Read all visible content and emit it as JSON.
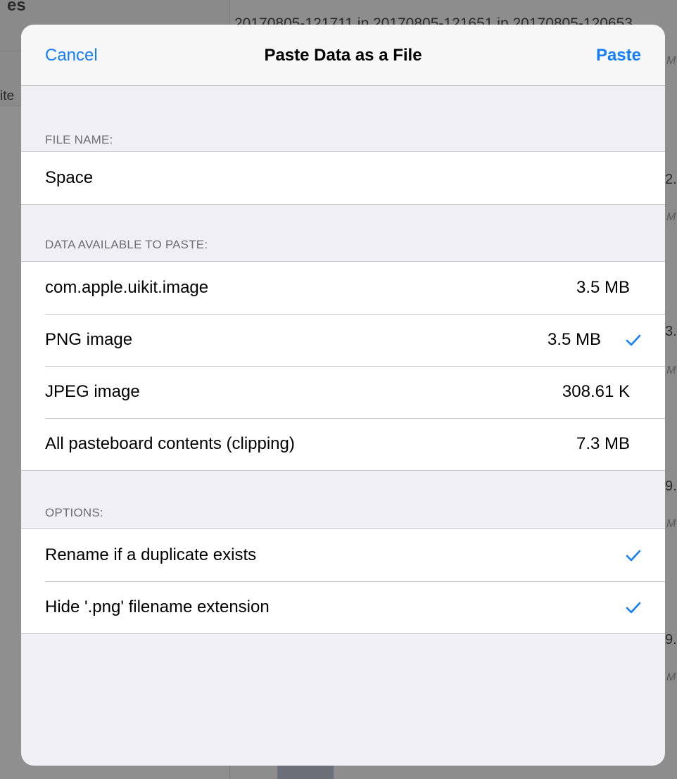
{
  "background": {
    "left_title_fragment": "es",
    "left_button_fragment": "ite",
    "filenames_row": "20170805-121711.jp  20170805-121651.jp  20170805-120653.",
    "right_edge_fragments": [
      "M",
      "2.",
      "M",
      "3.",
      "M",
      "9.",
      "M",
      "9.",
      "M"
    ]
  },
  "nav": {
    "cancel_label": "Cancel",
    "title": "Paste Data as a File",
    "paste_label": "Paste"
  },
  "file_name": {
    "header": "FILE NAME:",
    "value": "Space"
  },
  "data_available": {
    "header": "DATA AVAILABLE TO PASTE:",
    "items": [
      {
        "label": "com.apple.uikit.image",
        "size": "3.5 MB",
        "selected": false
      },
      {
        "label": "PNG image",
        "size": "3.5 MB",
        "selected": true
      },
      {
        "label": "JPEG image",
        "size": "308.61 K",
        "selected": false
      },
      {
        "label": "All pasteboard contents (clipping)",
        "size": "7.3 MB",
        "selected": false
      }
    ]
  },
  "options": {
    "header": "OPTIONS:",
    "items": [
      {
        "label": "Rename if a duplicate exists",
        "checked": true
      },
      {
        "label": "Hide '.png' filename extension",
        "checked": true
      }
    ]
  },
  "colors": {
    "accent": "#147efb",
    "grouped_background": "#efeff4",
    "separator": "#c8c7cc",
    "section_header_text": "#6d6d72"
  },
  "icons": {
    "checkmark": "checkmark-icon"
  }
}
